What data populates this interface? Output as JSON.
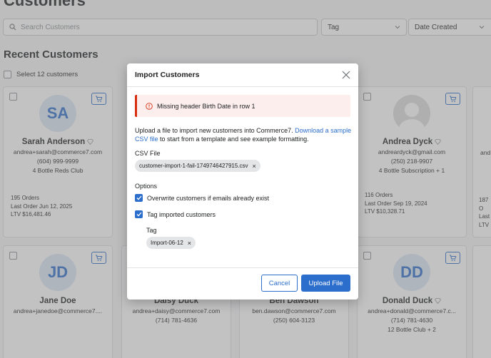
{
  "page": {
    "title": "Customers",
    "search_placeholder": "Search Customers",
    "filter_tag": "Tag",
    "sort": "Date Created",
    "section_title": "Recent Customers",
    "select_all": "Select 12 customers"
  },
  "cards": [
    {
      "initials": "SA",
      "name": "Sarah Anderson",
      "email": "andrea+sarah@commerce7.com",
      "phone": "(604) 999-9999",
      "club": "4 Bottle Reds Club",
      "orders": "195 Orders",
      "last_order": "Last Order Jun 12, 2025",
      "ltv": "LTV  $16,481.46"
    },
    {
      "initials": "",
      "name": "Andrea Dyck",
      "email": "andreardyck@gmail.com",
      "phone": "(250) 218-9907",
      "club": "4 Bottle Subscription + 1",
      "orders": "116 Orders",
      "last_order": "Last Order Sep 19, 2024",
      "ltv": "LTV  $10,328.71"
    },
    {
      "partial_email": "and",
      "orders": "187 O",
      "last_order": "Last",
      "ltv": "LTV"
    },
    {
      "initials": "JD",
      "name": "Jane Doe",
      "email": "andrea+janedoe@commerce7...."
    },
    {
      "name": "Daisy Duck",
      "email": "andrea+daisy@commerce7.com",
      "phone": "(714) 781-4636"
    },
    {
      "name": "Ben Dawson",
      "email": "ben.dawson@commerce7.com",
      "phone": "(250) 604-3123"
    },
    {
      "initials": "DD",
      "name": "Donald Duck",
      "email": "andrea+donald@commerce7.c...",
      "phone": "(714) 781-4630",
      "club": "12 Bottle Club + 2"
    }
  ],
  "modal": {
    "title": "Import Customers",
    "error": "Missing header Birth Date in row 1",
    "desc_pre": "Upload a file to import new customers into Commerce7. ",
    "desc_link": "Download a sample CSV file",
    "desc_post": " to start from a template and see example formatting.",
    "csv_label": "CSV File",
    "csv_file": "customer-import-1-fail-1749746427915.csv",
    "options_label": "Options",
    "opt_overwrite": "Overwrite customers if emails already exist",
    "opt_tag": "Tag imported customers",
    "tag_label": "Tag",
    "tag_value": "Import-06-12",
    "cancel": "Cancel",
    "upload": "Upload File"
  },
  "colors": {
    "accent": "#2c6ecb",
    "error": "#d72c0d",
    "error_bg": "#fdeeee"
  }
}
